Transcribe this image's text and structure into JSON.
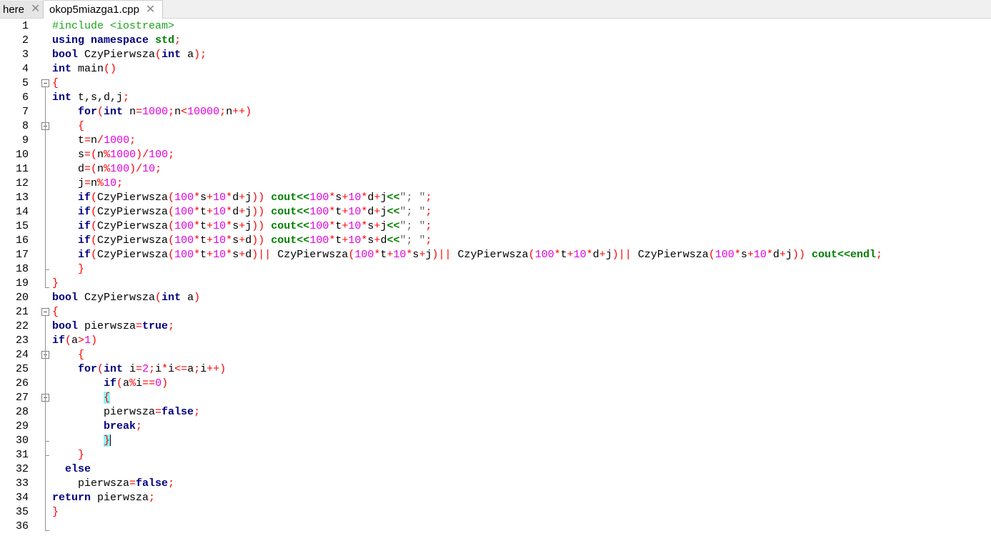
{
  "tabs": [
    {
      "label": "here",
      "close": "✕"
    },
    {
      "label": "okop5miazga1.cpp",
      "close": "✕"
    }
  ],
  "editor": {
    "lines": [
      {
        "n": "1",
        "t": "#include <iostream>"
      },
      {
        "n": "2",
        "t": "using namespace std;"
      },
      {
        "n": "3",
        "t": "bool CzyPierwsza(int a);"
      },
      {
        "n": "4",
        "t": "int main()"
      },
      {
        "n": "5",
        "t": "{"
      },
      {
        "n": "6",
        "t": "int t,s,d,j;"
      },
      {
        "n": "7",
        "t": "    for(int n=1000;n<10000;n++)"
      },
      {
        "n": "8",
        "t": "    {"
      },
      {
        "n": "9",
        "t": "    t=n/1000;"
      },
      {
        "n": "10",
        "t": "    s=(n%1000)/100;"
      },
      {
        "n": "11",
        "t": "    d=(n%100)/10;"
      },
      {
        "n": "12",
        "t": "    j=n%10;"
      },
      {
        "n": "13",
        "t": "    if(CzyPierwsza(100*s+10*d+j)) cout<<100*s+10*d+j<<\"; \";"
      },
      {
        "n": "14",
        "t": "    if(CzyPierwsza(100*t+10*d+j)) cout<<100*t+10*d+j<<\"; \";"
      },
      {
        "n": "15",
        "t": "    if(CzyPierwsza(100*t+10*s+j)) cout<<100*t+10*s+j<<\"; \";"
      },
      {
        "n": "16",
        "t": "    if(CzyPierwsza(100*t+10*s+d)) cout<<100*t+10*s+d<<\"; \";"
      },
      {
        "n": "17",
        "t": "    if(CzyPierwsza(100*t+10*s+d)|| CzyPierwsza(100*t+10*s+j)|| CzyPierwsza(100*t+10*d+j)|| CzyPierwsza(100*s+10*d+j)) cout<<endl;"
      },
      {
        "n": "18",
        "t": "    }"
      },
      {
        "n": "19",
        "t": "}"
      },
      {
        "n": "20",
        "t": "bool CzyPierwsza(int a)"
      },
      {
        "n": "21",
        "t": "{"
      },
      {
        "n": "22",
        "t": "bool pierwsza=true;"
      },
      {
        "n": "23",
        "t": "if(a>1)"
      },
      {
        "n": "24",
        "t": "    {"
      },
      {
        "n": "25",
        "t": "    for(int i=2;i*i<=a;i++)"
      },
      {
        "n": "26",
        "t": "        if(a%i==0)"
      },
      {
        "n": "27",
        "t": "        {"
      },
      {
        "n": "28",
        "t": "        pierwsza=false;"
      },
      {
        "n": "29",
        "t": "        break;"
      },
      {
        "n": "30",
        "t": "        }"
      },
      {
        "n": "31",
        "t": "    }"
      },
      {
        "n": "32",
        "t": "  else"
      },
      {
        "n": "33",
        "t": "    pierwsza=false;"
      },
      {
        "n": "34",
        "t": "return pierwsza;"
      },
      {
        "n": "35",
        "t": "}"
      },
      {
        "n": "36",
        "t": ""
      }
    ],
    "fold_markers": [
      "5",
      "8",
      "21",
      "24",
      "27"
    ],
    "caret_line": "30",
    "brace_highlight_lines": [
      "27",
      "30"
    ]
  },
  "colors": {
    "keyword": "#00007f",
    "preprocessor": "#1ea31e",
    "operator": "#ff0000",
    "number": "#e000e0",
    "string": "#666666",
    "stream": "#008000",
    "brace_highlight": "#8ff5f5"
  },
  "icons": {
    "tab_close": "close-icon",
    "fold": "fold-minus-icon"
  }
}
